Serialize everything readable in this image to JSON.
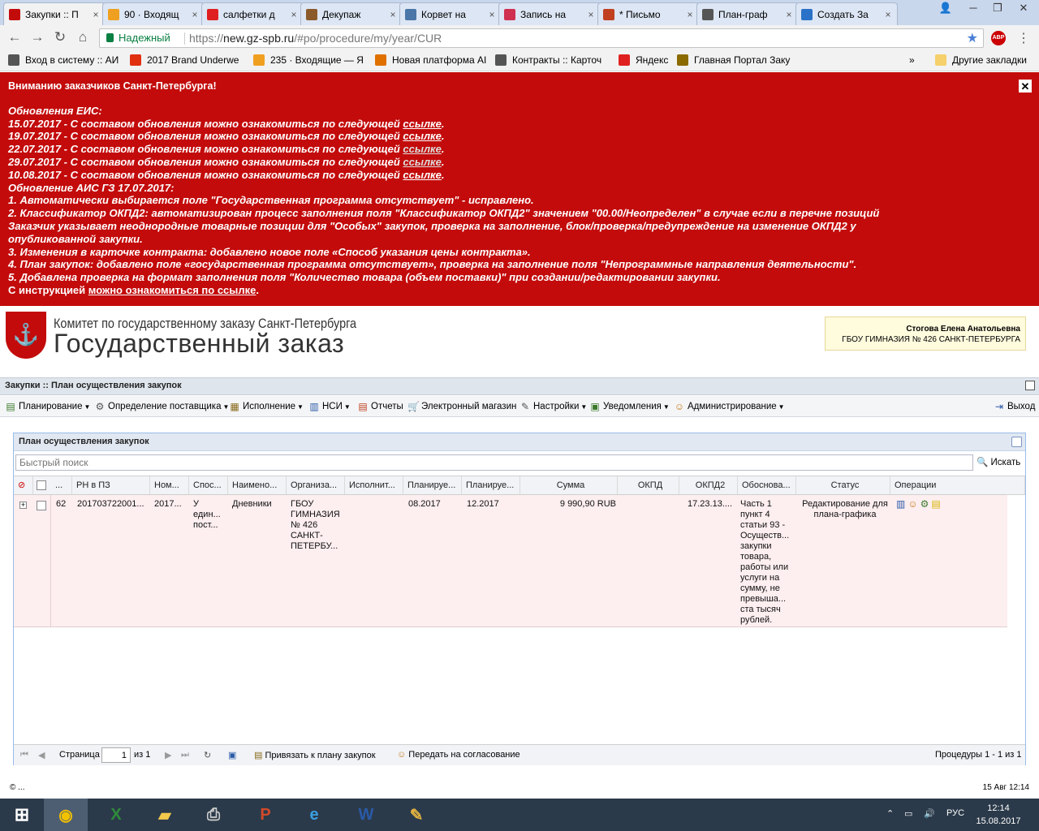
{
  "tabs": [
    {
      "title": "Закупки :: П",
      "color": "#c30b0b"
    },
    {
      "title": "90 · Входящ",
      "color": "#f0a020"
    },
    {
      "title": "салфетки д",
      "color": "#e02020"
    },
    {
      "title": "Декупаж",
      "color": "#8b5a2b"
    },
    {
      "title": "Корвет на",
      "color": "#4a76a8"
    },
    {
      "title": "Запись на",
      "color": "#d03050"
    },
    {
      "title": "* Письмо",
      "color": "#c04020"
    },
    {
      "title": "План-граф",
      "color": "#555555"
    },
    {
      "title": "Создать За",
      "color": "#2a72c8"
    }
  ],
  "address": {
    "secure": "Надежный",
    "url_scheme": "https://",
    "url_domain": "new.gz-spb.ru",
    "url_path": "/#po/procedure/my/year/CUR",
    "abp": "ABP"
  },
  "bookmarks": [
    {
      "label": "Вход в систему :: АИ",
      "color": "#555"
    },
    {
      "label": "2017 Brand Underwe",
      "color": "#e03010"
    },
    {
      "label": "235 · Входящие — Я",
      "color": "#f0a020"
    },
    {
      "label": "Новая платформа АІ",
      "color": "#e07000"
    },
    {
      "label": "Контракты :: Карточ",
      "color": "#555"
    },
    {
      "label": "Яндекс",
      "color": "#e02020"
    },
    {
      "label": "Главная Портал Заку",
      "color": "#8b6a00"
    }
  ],
  "bookmarks_more": "»",
  "bookmarks_other": "Другие закладки",
  "notice": {
    "title": "Вниманию заказчиков Санкт-Петербурга!",
    "eis": "Обновления ЕИС:",
    "eis_updates": [
      {
        "text": "15.07.2017 - С составом обновления можно ознакомиться по следующей ",
        "link": "ссылке"
      },
      {
        "text": "19.07.2017 - С составом обновления можно ознакомиться по следующей ",
        "link": "ссылке"
      },
      {
        "text": "22.07.2017 - С составом обновления можно ознакомиться по следующей ",
        "link": "ссылке"
      },
      {
        "text": "29.07.2017 - С составом обновления можно ознакомиться по следующей ",
        "link": "ссылке"
      },
      {
        "text": "10.08.2017 - С составом обновления можно ознакомиться по следующей ",
        "link": "ссылке"
      }
    ],
    "ais": "Обновление АИС ГЗ 17.07.2017:",
    "ais_lines": [
      "1. Автоматически выбирается поле \"Государственная программа отсутствует\" - исправлено.",
      "2. Классификатор ОКПД2: автоматизирован процесс заполнения поля \"Классификатор ОКПД2\" значением \"00.00/Неопределен\" в случае если в перечне позиций",
      "Заказчик указывает неоднородные товарные позиции для \"Особых\" закупок, проверка на заполнение, блок/проверка/предупреждение на изменение ОКПД2 у",
      "опубликованной закупки.",
      "3. Изменения в карточке контракта: добавлено новое поле «Способ указания цены контракта».",
      "4. План закупок: добавлено поле «государственная программа отсутствует», проверка на заполнение поля \"Непрограммные направления деятельности\".",
      "5. Добавлена проверка на формат заполнения поля \"Количество товара (объем поставки)\" при создании/редактировании закупки."
    ],
    "instr_text": "С инструкцией ",
    "instr_link": "можно ознакомиться по ссылке",
    "instr_end": ".",
    "close": "✕"
  },
  "header": {
    "org_line1": "Комитет по государственному заказу Санкт-Петербурга",
    "org_line2": "Государственный заказ",
    "user_name": "Стогова Елена Анатольевна",
    "user_org": "ГБОУ ГИМНАЗИЯ № 426 САНКТ-ПЕТЕРБУРГА"
  },
  "panel_title": "Закупки :: План осуществления закупок",
  "menu": [
    {
      "label": "Планирование",
      "drop": true
    },
    {
      "label": "Определение поставщика",
      "drop": true
    },
    {
      "label": "Исполнение",
      "drop": true
    },
    {
      "label": "НСИ",
      "drop": true
    },
    {
      "label": "Отчеты",
      "drop": false
    },
    {
      "label": "Электронный магазин",
      "drop": false
    },
    {
      "label": "Настройки",
      "drop": true
    },
    {
      "label": "Уведомления",
      "drop": true
    },
    {
      "label": "Администрирование",
      "drop": true
    }
  ],
  "exit_label": "Выход",
  "grid": {
    "title": "План осуществления закупок",
    "search_placeholder": "Быстрый поиск",
    "search_button": "Искать",
    "columns": [
      "...",
      "РН в ПЗ",
      "Ном...",
      "Спос...",
      "Наимено...",
      "Организа...",
      "Исполнит...",
      "Планируе...",
      "Планируе...",
      "Сумма",
      "ОКПД",
      "ОКПД2",
      "Обоснова...",
      "Статус",
      "Операции"
    ],
    "row": {
      "num": "62",
      "rn": "201703722001...",
      "nom": "2017...",
      "sposob": "У един... пост...",
      "name": "Дневники",
      "org": "ГБОУ ГИМНАЗИЯ № 426 САНКТ-ПЕТЕРБУ...",
      "isp": "",
      "plan1": "08.2017",
      "plan2": "12.2017",
      "sum": "9 990,90 RUB",
      "okpd": "",
      "okpd2": "17.23.13....",
      "osnov": "Часть 1 пункт 4 статьи 93 - Осуществ... закупки товара, работы или услуги на сумму, не превыша... ста тысяч рублей.",
      "status": "Редактирование для плана-графика"
    },
    "pager": {
      "page_label": "Страница",
      "page_value": "1",
      "of": "из 1",
      "attach": "Привязать к плану закупок",
      "approve": "Передать на согласование",
      "summary": "Процедуры 1 - 1 из 1"
    }
  },
  "footer": {
    "copy": "© ...",
    "datetime": "15 Авг 12:14"
  },
  "taskbar": {
    "lang": "РУС",
    "time": "12:14",
    "date": "15.08.2017"
  }
}
